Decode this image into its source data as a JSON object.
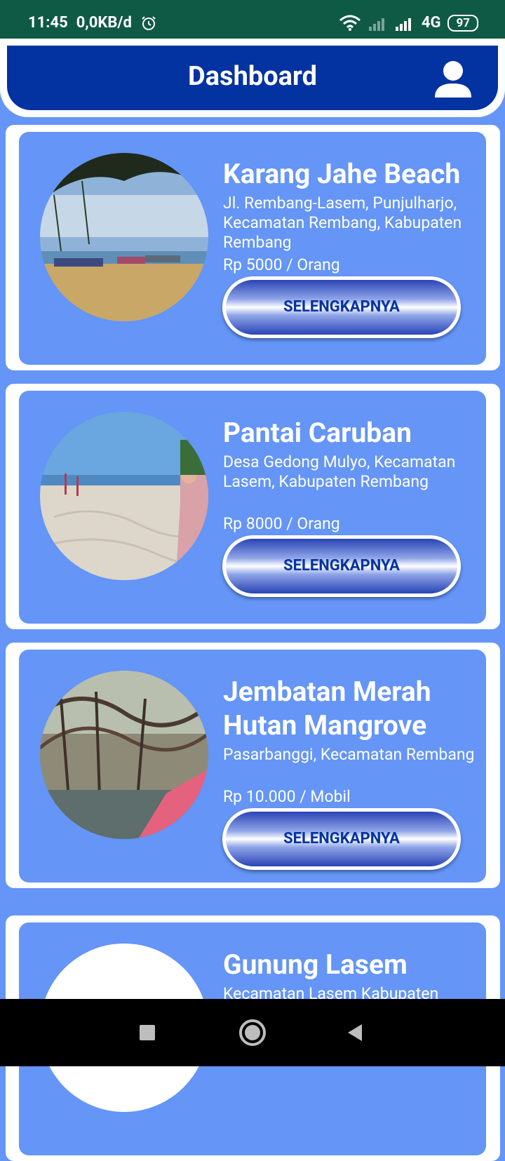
{
  "status_bar": {
    "time": "11:45",
    "net_speed": "0,0KB/d",
    "network": "4G",
    "battery": "97"
  },
  "header": {
    "title": "Dashboard"
  },
  "cards": [
    {
      "title": "Karang Jahe Beach",
      "address": "Jl. Rembang-Lasem, Punjulharjo, Kecamatan Rembang, Kabupaten Rembang",
      "price": "Rp 5000 / Orang",
      "button": "SELENGKAPNYA"
    },
    {
      "title": "Pantai Caruban",
      "address": "Desa Gedong Mulyo, Kecamatan Lasem, Kabupaten Rembang",
      "price": "Rp 8000 / Orang",
      "button": "SELENGKAPNYA"
    },
    {
      "title": "Jembatan Merah Hutan Mangrove",
      "address": "Pasarbanggi, Kecamatan Rembang",
      "price": "Rp 10.000 / Mobil",
      "button": "SELENGKAPNYA"
    },
    {
      "title": "Gunung Lasem",
      "address": "Kecamatan Lasem Kabupaten"
    }
  ],
  "colors": {
    "status_bar": "#0f5a45",
    "header": "#0233a1",
    "card": "#6495f7",
    "button_text": "#0233a1"
  },
  "icons": [
    "alarm-icon",
    "wifi-icon",
    "signal-icon",
    "profile-icon",
    "recent-apps-icon",
    "home-icon",
    "back-icon"
  ]
}
